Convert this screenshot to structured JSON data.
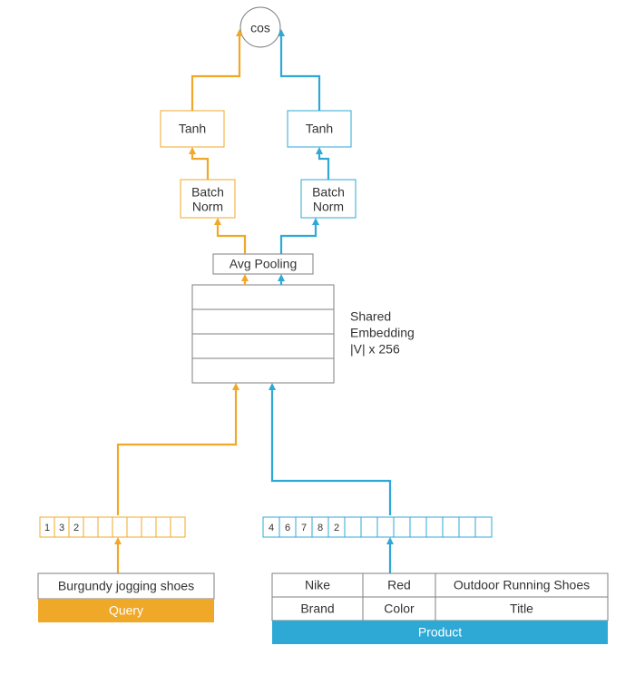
{
  "top": {
    "cos_label": "cos",
    "tanh_left": "Tanh",
    "tanh_right": "Tanh",
    "batchnorm_left_line1": "Batch",
    "batchnorm_left_line2": "Norm",
    "batchnorm_right_line1": "Batch",
    "batchnorm_right_line2": "Norm",
    "avgpool": "Avg Pooling"
  },
  "embedding": {
    "side_label_line1": "Shared",
    "side_label_line2": "Embedding",
    "side_label_line3": "|V| x 256"
  },
  "query": {
    "tokens": [
      "1",
      "3",
      "2",
      "",
      "",
      "",
      "",
      "",
      "",
      ""
    ],
    "text": "Burgundy jogging shoes",
    "label": "Query"
  },
  "product": {
    "tokens": [
      "4",
      "6",
      "7",
      "8",
      "2",
      "",
      "",
      "",
      "",
      "",
      "",
      "",
      "",
      ""
    ],
    "row_values": [
      "Nike",
      "Red",
      "Outdoor Running Shoes"
    ],
    "row_headers": [
      "Brand",
      "Color",
      "Title"
    ],
    "label": "Product"
  }
}
